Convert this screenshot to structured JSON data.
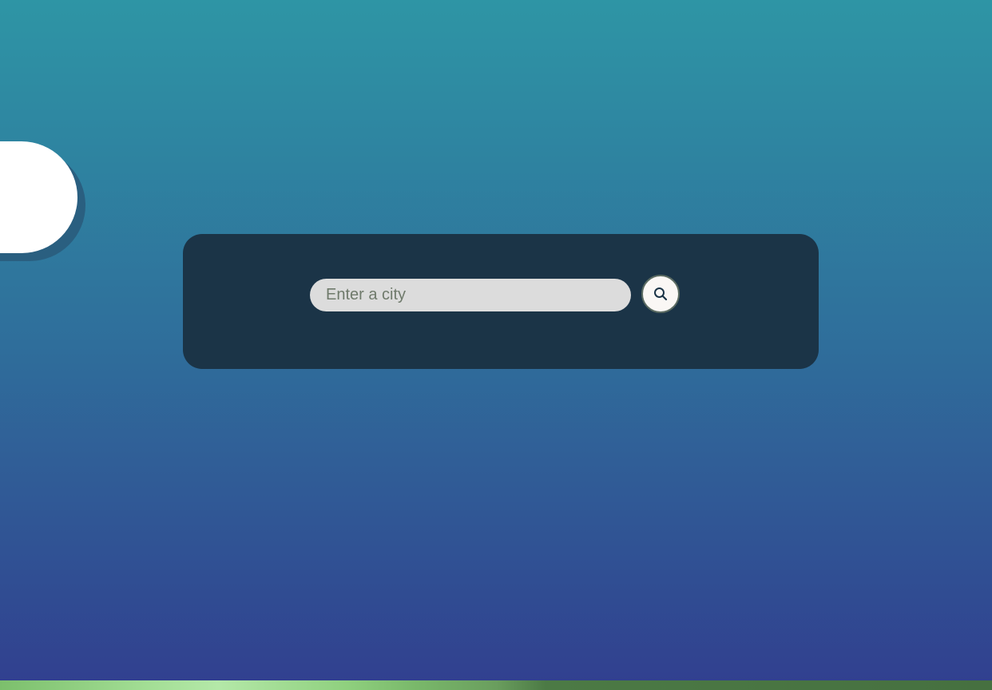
{
  "search": {
    "placeholder": "Enter a city",
    "value": "",
    "button_icon": "search-icon"
  },
  "colors": {
    "background_top": "#2e95a5",
    "background_bottom": "#313f8f",
    "card": "#1b3447",
    "input": "#dcdcdc",
    "button": "#faf7f5",
    "ground": "#7cbf6c"
  }
}
